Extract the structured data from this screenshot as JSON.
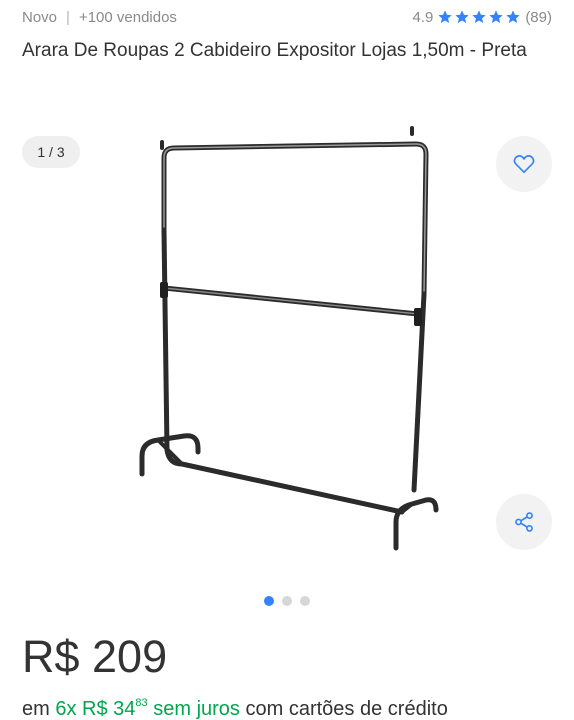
{
  "meta": {
    "condition": "Novo",
    "separator": "|",
    "sold": "+100 vendidos",
    "rating": "4.9",
    "stars": 5,
    "reviews": "(89)"
  },
  "title": "Arara De Roupas 2 Cabideiro Expositor Lojas 1,50m - Preta",
  "gallery": {
    "counter": "1 / 3",
    "image": "clothes-rack-image",
    "favorite_icon": "heart-icon",
    "share_icon": "share-icon",
    "dots": 3,
    "active_dot": 0
  },
  "price": {
    "value": "R$ 209"
  },
  "installments": {
    "prefix": "em",
    "count": "6x",
    "amount": "R$ 34",
    "cents": "83",
    "no_interest": "sem juros",
    "suffix": "com cartões de crédito"
  },
  "colors": {
    "accent_blue": "#3483fa",
    "green": "#00a650",
    "text": "#333333",
    "muted": "#8a8a8a"
  }
}
